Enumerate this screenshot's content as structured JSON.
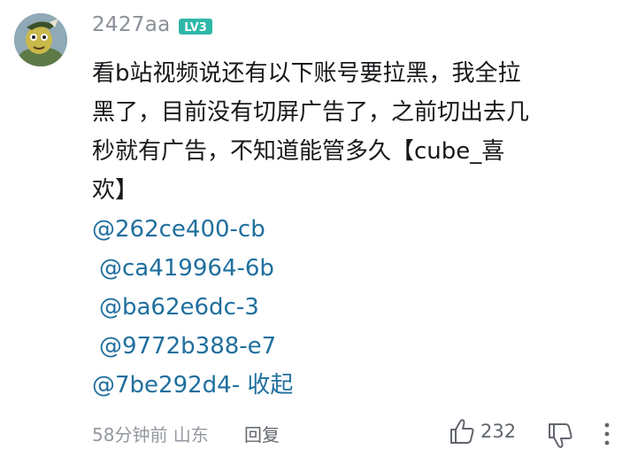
{
  "comment": {
    "username": "2427aa",
    "level_badge": "LV3",
    "text_lines": [
      "看b站视频说还有以下账号要拉黑，我全拉",
      "黑了，目前没有切屏广告了，之前切出去几",
      "秒就有广告，不知道能管多久【cube_喜",
      "欢】"
    ],
    "mentions": [
      "@262ce400-cb",
      "@ca419964-6b",
      "@ba62e6dc-3",
      "@9772b388-e7",
      "@7be292d4-"
    ],
    "collapse_label": "收起",
    "time_location": "58分钟前  山东",
    "reply_label": "回复",
    "like_count": "232"
  },
  "icons": {
    "like": "thumbs-up-icon",
    "dislike": "thumbs-down-icon",
    "more": "more-vertical-icon"
  },
  "colors": {
    "link": "#1f6f9e",
    "level_badge": "#2fb8a8",
    "meta": "#9499a0"
  }
}
